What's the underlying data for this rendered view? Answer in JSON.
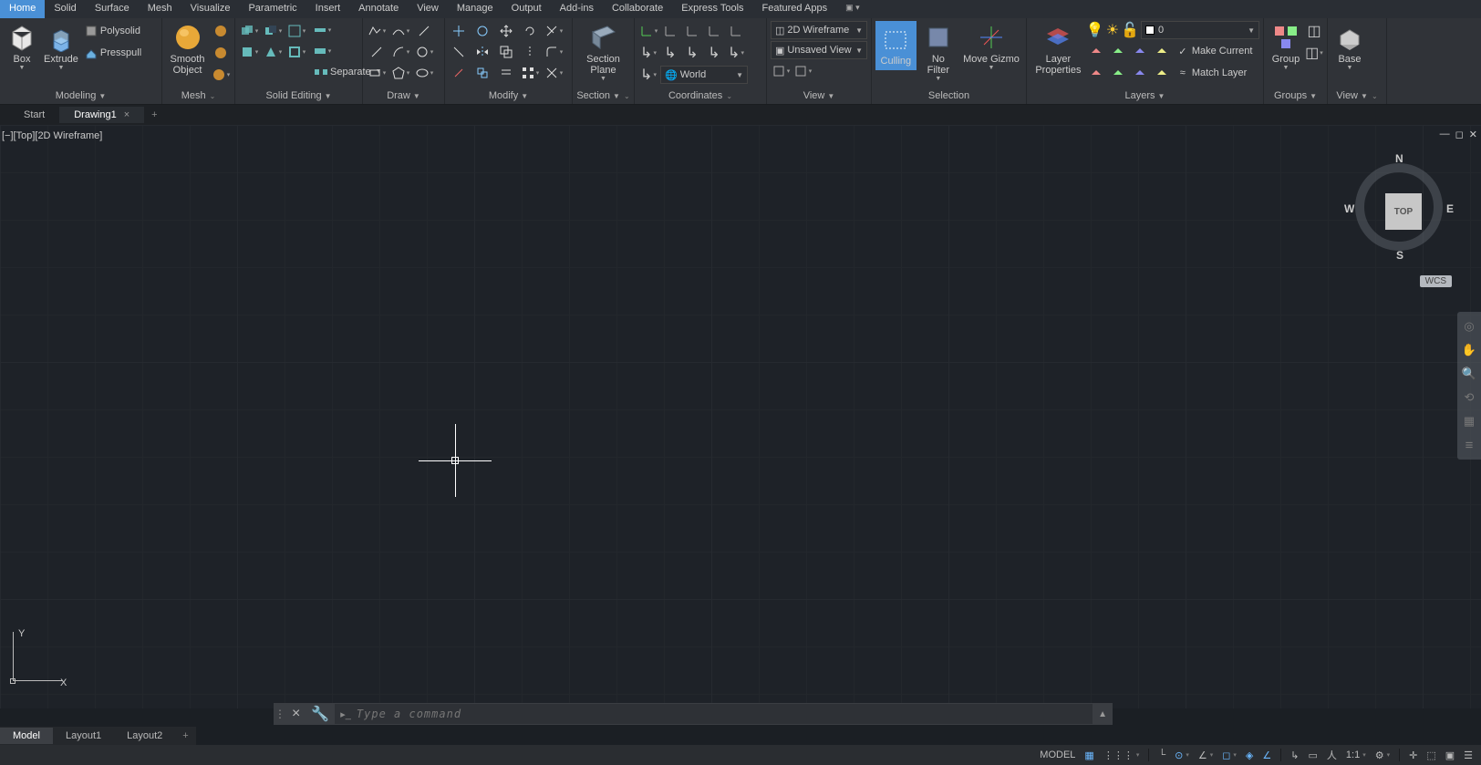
{
  "tabs": [
    "Home",
    "Solid",
    "Surface",
    "Mesh",
    "Visualize",
    "Parametric",
    "Insert",
    "Annotate",
    "View",
    "Manage",
    "Output",
    "Add-ins",
    "Collaborate",
    "Express Tools",
    "Featured Apps"
  ],
  "active_tab": "Home",
  "ribbon": {
    "modeling": {
      "title": "Modeling",
      "box": "Box",
      "extrude": "Extrude",
      "polysolid": "Polysolid",
      "presspull": "Presspull"
    },
    "mesh": {
      "title": "Mesh",
      "smooth": "Smooth Object"
    },
    "solid_editing": {
      "title": "Solid Editing",
      "separate": "Separate"
    },
    "draw": {
      "title": "Draw"
    },
    "modify": {
      "title": "Modify"
    },
    "section": {
      "title": "Section",
      "plane": "Section Plane"
    },
    "coordinates": {
      "title": "Coordinates",
      "world": "World"
    },
    "view": {
      "title": "View",
      "visual_style": "2D Wireframe",
      "unsaved": "Unsaved View"
    },
    "selection": {
      "title": "Selection",
      "culling": "Culling",
      "nofilter": "No Filter",
      "move_gizmo": "Move Gizmo"
    },
    "layers": {
      "title": "Layers",
      "layer_props": "Layer Properties",
      "current_layer": "0",
      "make_current": "Make Current",
      "match_layer": "Match Layer"
    },
    "groups": {
      "title": "Groups",
      "group": "Group"
    },
    "viewpanel": {
      "title": "View",
      "base": "Base"
    }
  },
  "filetabs": {
    "start": "Start",
    "active": "Drawing1"
  },
  "viewport": {
    "label": "[−][Top][2D Wireframe]",
    "cube_face": "TOP",
    "wcs": "WCS",
    "ucs_y": "Y",
    "ucs_x": "X",
    "compass": {
      "n": "N",
      "s": "S",
      "e": "E",
      "w": "W"
    }
  },
  "cmdline": {
    "placeholder": "Type a command"
  },
  "layout_tabs": [
    "Model",
    "Layout1",
    "Layout2"
  ],
  "active_layout": "Model",
  "status": {
    "model": "MODEL",
    "scale": "1:1"
  }
}
